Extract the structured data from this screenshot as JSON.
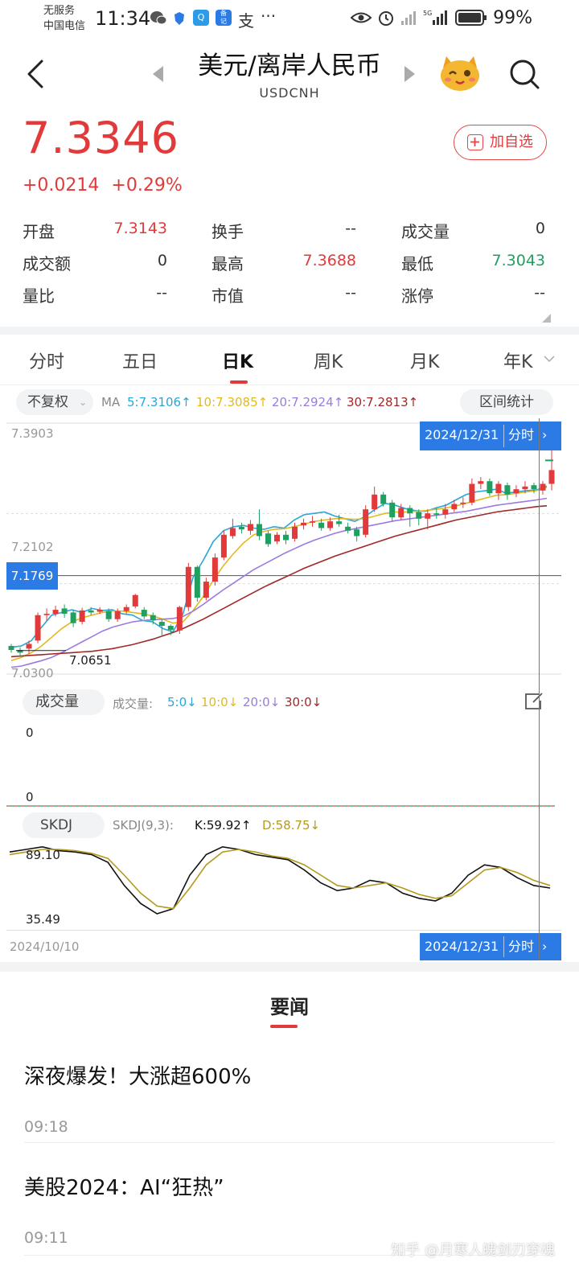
{
  "status_bar": {
    "carrier_line1": "无服务",
    "carrier_line2": "中国电信",
    "time": "11:34",
    "battery": "99%",
    "icons": [
      "wechat-icon",
      "shield-icon",
      "search-app-icon",
      "notes-app-icon",
      "alipay-icon",
      "more-dots-icon",
      "eye-icon",
      "alarm-icon",
      "signal-icon",
      "5g-signal-icon",
      "battery-icon"
    ]
  },
  "header": {
    "title": "美元/离岸人民币",
    "subtitle": "USDCNH"
  },
  "quote": {
    "price": "7.3346",
    "change": "+0.0214",
    "change_pct": "+0.29%",
    "add_watchlist": "加自选",
    "color_up": "#e23a3a",
    "color_down": "#20a060"
  },
  "stats": [
    {
      "label": "开盘",
      "value": "7.3143",
      "color": "#e23a3a"
    },
    {
      "label": "换手",
      "value": "--",
      "color": "#333333"
    },
    {
      "label": "成交量",
      "value": "0",
      "color": "#333333"
    },
    {
      "label": "成交额",
      "value": "0",
      "color": "#333333"
    },
    {
      "label": "最高",
      "value": "7.3688",
      "color": "#e23a3a"
    },
    {
      "label": "最低",
      "value": "7.3043",
      "color": "#20a060"
    },
    {
      "label": "量比",
      "value": "--",
      "color": "#333333"
    },
    {
      "label": "市值",
      "value": "--",
      "color": "#333333"
    },
    {
      "label": "涨停",
      "value": "--",
      "color": "#333333"
    }
  ],
  "tabs": [
    "分时",
    "五日",
    "日K",
    "周K",
    "月K",
    "年K"
  ],
  "active_tab": "日K",
  "chart_controls": {
    "adjust": "不复权",
    "ma_label": "MA",
    "ma5": "5:7.3106↑",
    "ma10": "10:7.3085↑",
    "ma20": "20:7.2924↑",
    "ma30": "30:7.2813↑",
    "range_stats": "区间统计"
  },
  "price_axis": {
    "top": "7.3903",
    "mid": "7.2102",
    "bottom": "7.0300",
    "crosshair": "7.1769",
    "low_marker": "7.0651",
    "date_box": "2024/12/31",
    "intraday": "分时"
  },
  "volume": {
    "selector": "成交量",
    "label": "成交量:",
    "v5": "5:0↓",
    "v10": "10:0↓",
    "v20": "20:0↓",
    "v30": "30:0↓",
    "axis_top": "0",
    "axis_bottom": "0"
  },
  "skdj": {
    "selector": "SKDJ",
    "label": "SKDJ(9,3):",
    "k": "K:59.92↑",
    "d": "D:58.75↓",
    "axis_top": "89.10",
    "axis_bottom": "35.49"
  },
  "date_axis": {
    "start": "2024/10/10",
    "end_box": "2024/12/31",
    "intraday": "分时"
  },
  "news": {
    "heading": "要闻",
    "items": [
      {
        "title": "深夜爆发！大涨超600%",
        "time": "09:18"
      },
      {
        "title": "美股2024：AI“狂热”",
        "time": "09:11"
      }
    ]
  },
  "watermark": "知乎 @月寒人魄剑刃穿魂",
  "chart_data": {
    "type": "candlestick",
    "title": "",
    "ylim": [
      7.03,
      7.3903
    ],
    "x_range": [
      "2024/10/10",
      "2024/12/31"
    ],
    "series": [
      {
        "name": "MA5",
        "color": "#2aa6d8",
        "values": [
          7.07,
          7.072,
          7.08,
          7.1,
          7.118,
          7.122,
          7.126,
          7.122,
          7.128,
          7.125,
          7.126,
          7.12,
          7.118,
          7.11,
          7.108,
          7.098,
          7.093,
          7.12,
          7.175,
          7.2,
          7.228,
          7.244,
          7.25,
          7.252,
          7.248,
          7.246,
          7.25,
          7.248,
          7.26,
          7.268,
          7.27,
          7.272,
          7.266,
          7.262,
          7.258,
          7.265,
          7.276,
          7.285,
          7.282,
          7.277,
          7.274,
          7.273,
          7.278,
          7.282,
          7.29,
          7.298,
          7.302,
          7.304,
          7.306,
          7.3,
          7.302,
          7.304,
          7.305,
          7.3106
        ]
      },
      {
        "name": "MA10",
        "color": "#e5b81e",
        "values": [
          7.05,
          7.055,
          7.062,
          7.072,
          7.085,
          7.098,
          7.108,
          7.114,
          7.118,
          7.122,
          7.124,
          7.124,
          7.122,
          7.12,
          7.117,
          7.112,
          7.106,
          7.108,
          7.125,
          7.146,
          7.17,
          7.192,
          7.21,
          7.226,
          7.238,
          7.243,
          7.246,
          7.247,
          7.25,
          7.254,
          7.258,
          7.26,
          7.262,
          7.262,
          7.261,
          7.262,
          7.266,
          7.27,
          7.272,
          7.272,
          7.273,
          7.274,
          7.276,
          7.278,
          7.281,
          7.285,
          7.289,
          7.293,
          7.297,
          7.298,
          7.3,
          7.302,
          7.304,
          7.3085
        ]
      },
      {
        "name": "MA20",
        "color": "#9b7be0",
        "values": [
          7.04,
          7.042,
          7.046,
          7.05,
          7.055,
          7.062,
          7.07,
          7.078,
          7.086,
          7.094,
          7.1,
          7.104,
          7.108,
          7.11,
          7.111,
          7.112,
          7.113,
          7.116,
          7.124,
          7.134,
          7.145,
          7.156,
          7.166,
          7.176,
          7.186,
          7.194,
          7.202,
          7.21,
          7.217,
          7.224,
          7.23,
          7.235,
          7.24,
          7.244,
          7.247,
          7.25,
          7.253,
          7.256,
          7.259,
          7.261,
          7.263,
          7.265,
          7.267,
          7.269,
          7.271,
          7.273,
          7.276,
          7.279,
          7.282,
          7.284,
          7.286,
          7.288,
          7.29,
          7.2924
        ]
      },
      {
        "name": "MA30",
        "color": "#a02828",
        "values": [
          7.056,
          7.057,
          7.058,
          7.059,
          7.06,
          7.061,
          7.062,
          7.063,
          7.064,
          7.066,
          7.068,
          7.071,
          7.074,
          7.078,
          7.082,
          7.087,
          7.092,
          7.098,
          7.105,
          7.112,
          7.12,
          7.128,
          7.136,
          7.144,
          7.152,
          7.16,
          7.167,
          7.174,
          7.181,
          7.188,
          7.194,
          7.2,
          7.206,
          7.211,
          7.216,
          7.221,
          7.226,
          7.231,
          7.236,
          7.24,
          7.244,
          7.248,
          7.252,
          7.256,
          7.26,
          7.263,
          7.266,
          7.269,
          7.272,
          7.274,
          7.276,
          7.278,
          7.28,
          7.2813
        ]
      }
    ],
    "candles": [
      [
        7.072,
        7.066,
        7.075,
        7.062
      ],
      [
        7.066,
        7.062,
        7.07,
        7.058
      ],
      [
        7.068,
        7.075,
        7.08,
        7.06
      ],
      [
        7.08,
        7.118,
        7.122,
        7.076
      ],
      [
        7.118,
        7.12,
        7.128,
        7.11
      ],
      [
        7.12,
        7.126,
        7.132,
        7.116
      ],
      [
        7.128,
        7.12,
        7.134,
        7.114
      ],
      [
        7.122,
        7.106,
        7.126,
        7.1
      ],
      [
        7.108,
        7.125,
        7.129,
        7.104
      ],
      [
        7.125,
        7.122,
        7.13,
        7.118
      ],
      [
        7.123,
        7.126,
        7.13,
        7.12
      ],
      [
        7.124,
        7.112,
        7.128,
        7.108
      ],
      [
        7.112,
        7.124,
        7.128,
        7.108
      ],
      [
        7.124,
        7.13,
        7.134,
        7.12
      ],
      [
        7.131,
        7.148,
        7.15,
        7.128
      ],
      [
        7.126,
        7.116,
        7.13,
        7.112
      ],
      [
        7.118,
        7.11,
        7.122,
        7.104
      ],
      [
        7.108,
        7.102,
        7.112,
        7.086
      ],
      [
        7.102,
        7.096,
        7.104,
        7.088
      ],
      [
        7.095,
        7.13,
        7.132,
        7.09
      ],
      [
        7.13,
        7.19,
        7.196,
        7.124
      ],
      [
        7.19,
        7.144,
        7.192,
        7.138
      ],
      [
        7.144,
        7.168,
        7.174,
        7.14
      ],
      [
        7.168,
        7.204,
        7.21,
        7.162
      ],
      [
        7.204,
        7.238,
        7.244,
        7.2
      ],
      [
        7.236,
        7.248,
        7.262,
        7.232
      ],
      [
        7.25,
        7.246,
        7.256,
        7.24
      ],
      [
        7.244,
        7.254,
        7.26,
        7.238
      ],
      [
        7.254,
        7.236,
        7.276,
        7.23
      ],
      [
        7.24,
        7.224,
        7.244,
        7.22
      ],
      [
        7.228,
        7.238,
        7.242,
        7.224
      ],
      [
        7.238,
        7.23,
        7.244,
        7.224
      ],
      [
        7.232,
        7.25,
        7.256,
        7.228
      ],
      [
        7.252,
        7.256,
        7.262,
        7.246
      ],
      [
        7.256,
        7.258,
        7.266,
        7.25
      ],
      [
        7.256,
        7.248,
        7.262,
        7.244
      ],
      [
        7.248,
        7.258,
        7.264,
        7.244
      ],
      [
        7.258,
        7.254,
        7.268,
        7.25
      ],
      [
        7.25,
        7.244,
        7.256,
        7.24
      ],
      [
        7.246,
        7.236,
        7.25,
        7.228
      ],
      [
        7.238,
        7.276,
        7.282,
        7.234
      ],
      [
        7.276,
        7.298,
        7.31,
        7.272
      ],
      [
        7.298,
        7.284,
        7.302,
        7.28
      ],
      [
        7.286,
        7.264,
        7.29,
        7.258
      ],
      [
        7.264,
        7.278,
        7.284,
        7.26
      ],
      [
        7.278,
        7.27,
        7.282,
        7.25
      ],
      [
        7.272,
        7.262,
        7.276,
        7.252
      ],
      [
        7.262,
        7.27,
        7.276,
        7.246
      ],
      [
        7.27,
        7.268,
        7.278,
        7.262
      ],
      [
        7.268,
        7.276,
        7.284,
        7.262
      ],
      [
        7.276,
        7.284,
        7.29,
        7.272
      ],
      [
        7.284,
        7.286,
        7.294,
        7.278
      ],
      [
        7.286,
        7.314,
        7.322,
        7.282
      ],
      [
        7.314,
        7.318,
        7.324,
        7.306
      ],
      [
        7.318,
        7.3,
        7.322,
        7.296
      ],
      [
        7.3,
        7.314,
        7.318,
        7.29
      ],
      [
        7.312,
        7.298,
        7.316,
        7.29
      ],
      [
        7.3,
        7.306,
        7.312,
        7.294
      ],
      [
        7.306,
        7.31,
        7.318,
        7.3
      ],
      [
        7.312,
        7.306,
        7.316,
        7.3
      ],
      [
        7.304,
        7.314,
        7.318,
        7.298
      ],
      [
        7.314,
        7.3346,
        7.3688,
        7.3043
      ]
    ],
    "skdj_series": [
      {
        "name": "K",
        "color": "#111111",
        "values": [
          88,
          90,
          92,
          89,
          88,
          86,
          80,
          62,
          48,
          40,
          44,
          70,
          86,
          92,
          90,
          86,
          84,
          82,
          74,
          64,
          58,
          60,
          66,
          64,
          56,
          52,
          50,
          56,
          70,
          78,
          76,
          68,
          62,
          60
        ]
      },
      {
        "name": "D",
        "color": "#b39a1e",
        "values": [
          86,
          88,
          90,
          90,
          89,
          87,
          83,
          70,
          56,
          46,
          44,
          60,
          78,
          88,
          90,
          88,
          85,
          83,
          78,
          70,
          62,
          60,
          62,
          64,
          60,
          55,
          52,
          54,
          64,
          74,
          76,
          72,
          66,
          62
        ]
      }
    ]
  }
}
